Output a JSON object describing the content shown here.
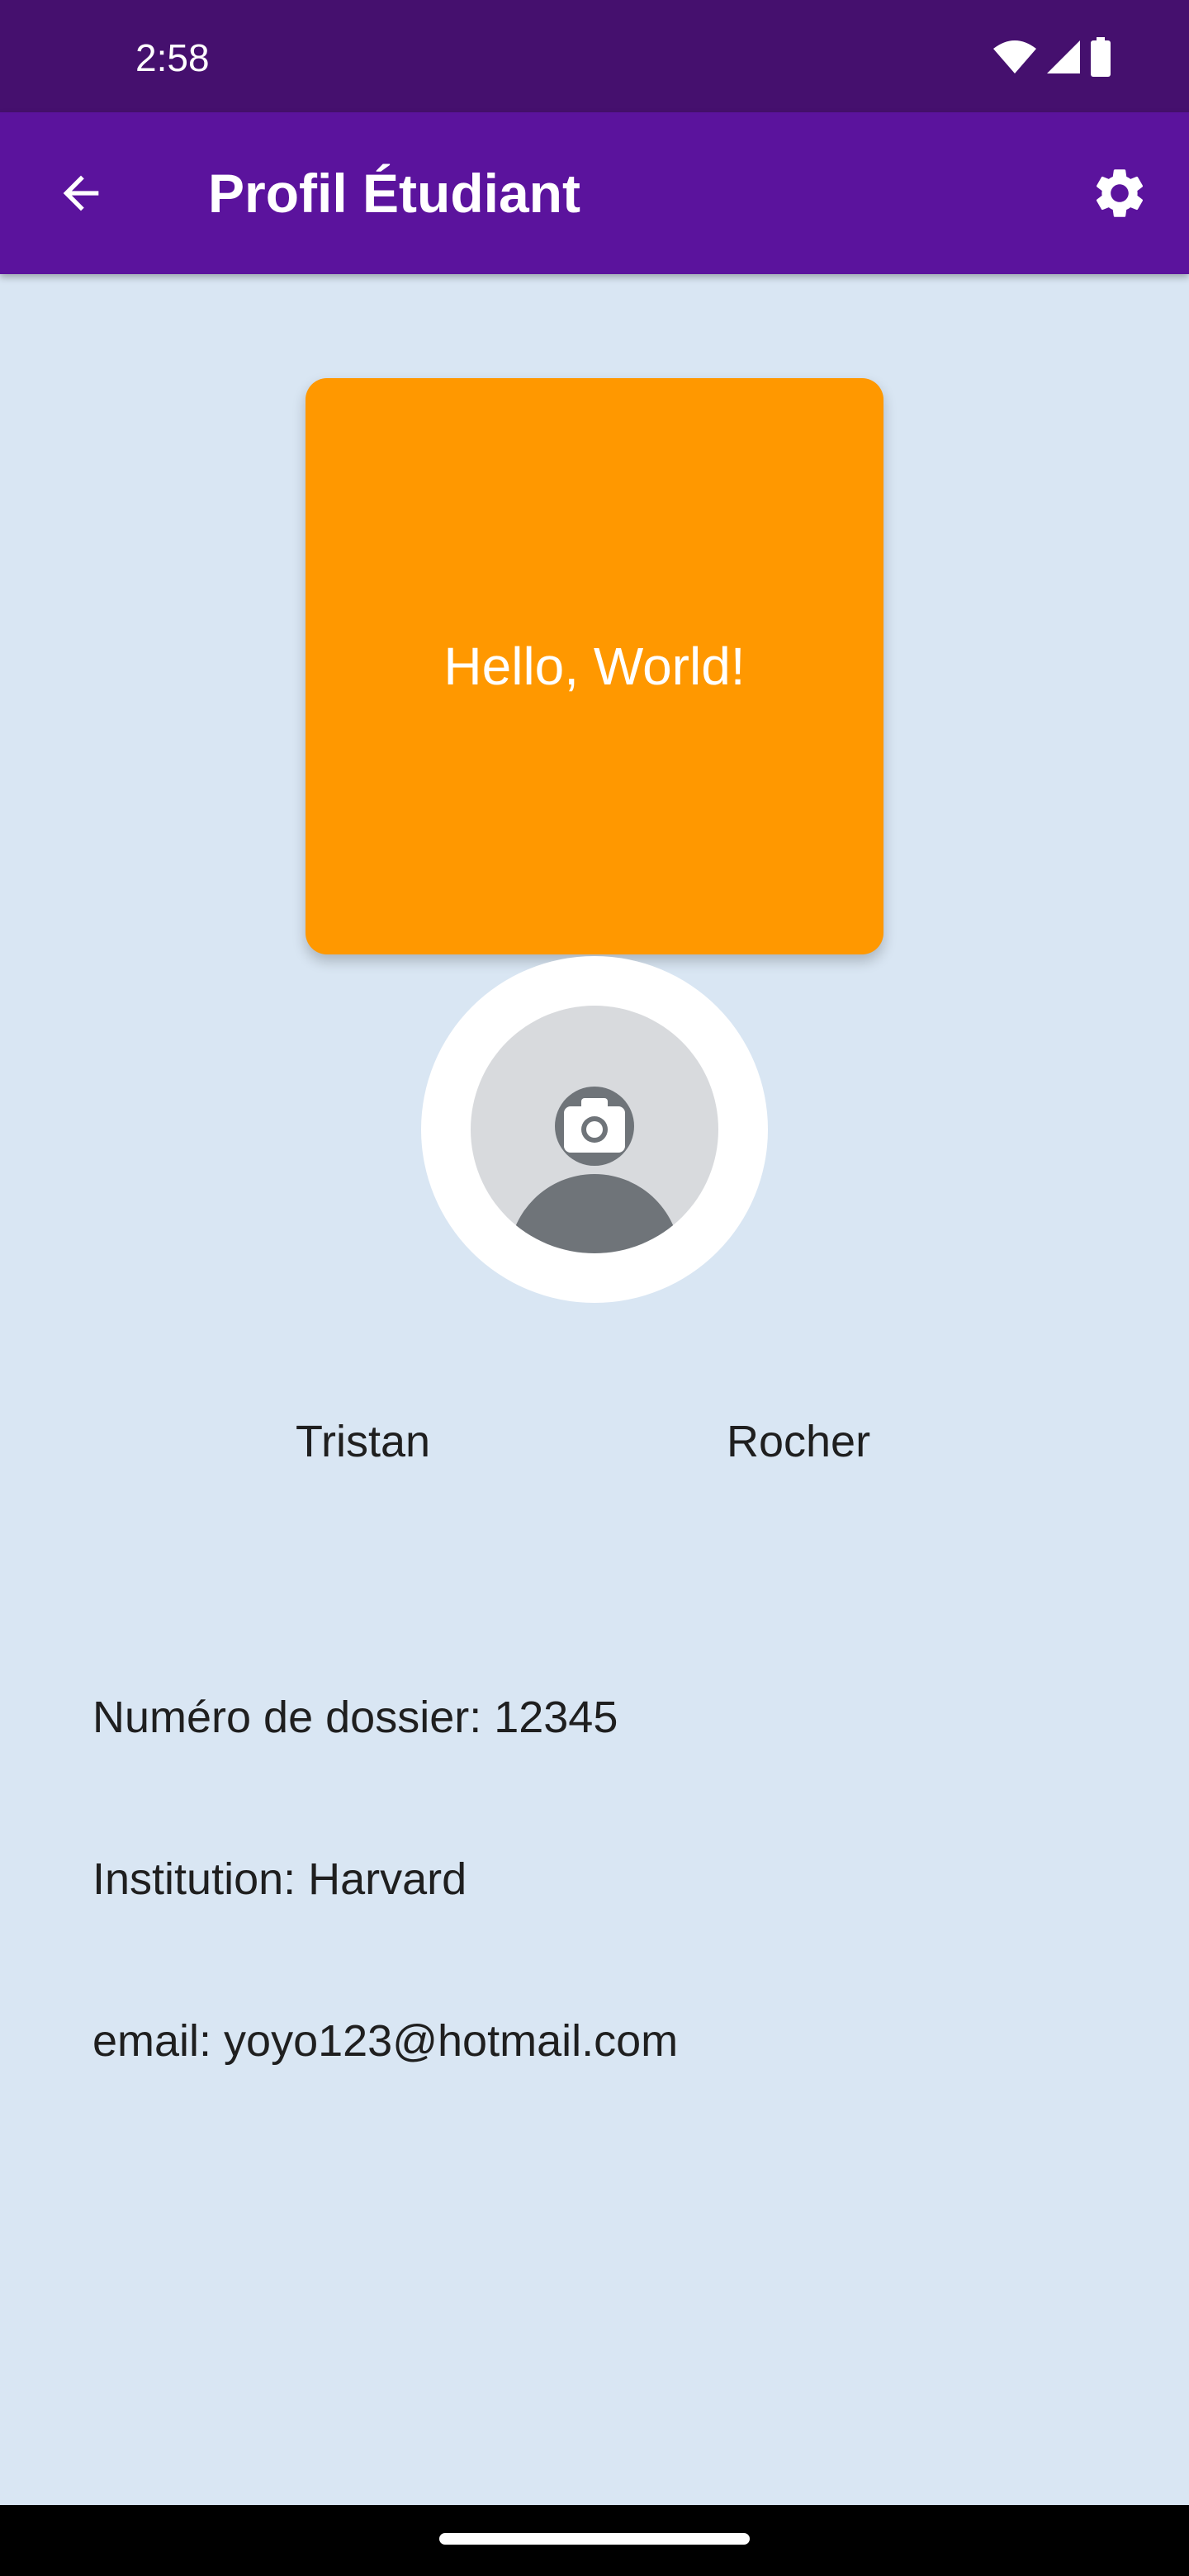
{
  "status_bar": {
    "time": "2:58",
    "icons": [
      "wifi-icon",
      "signal-icon",
      "battery-icon"
    ]
  },
  "app_bar": {
    "title": "Profil Étudiant",
    "back_icon": "arrow-back-icon",
    "settings_icon": "gear-icon"
  },
  "card": {
    "text": "Hello, World!",
    "color": "#ff9800"
  },
  "avatar": {
    "icon": "camera-icon"
  },
  "profile": {
    "first_name": "Tristan",
    "last_name": "Rocher",
    "file_number": "Numéro de dossier: 12345",
    "institution": "Institution: Harvard",
    "email": "email: yoyo123@hotmail.com"
  },
  "colors": {
    "status_bar": "#45106e",
    "app_bar": "#5b139d",
    "background": "#d9e6f3",
    "accent": "#ff9800"
  }
}
